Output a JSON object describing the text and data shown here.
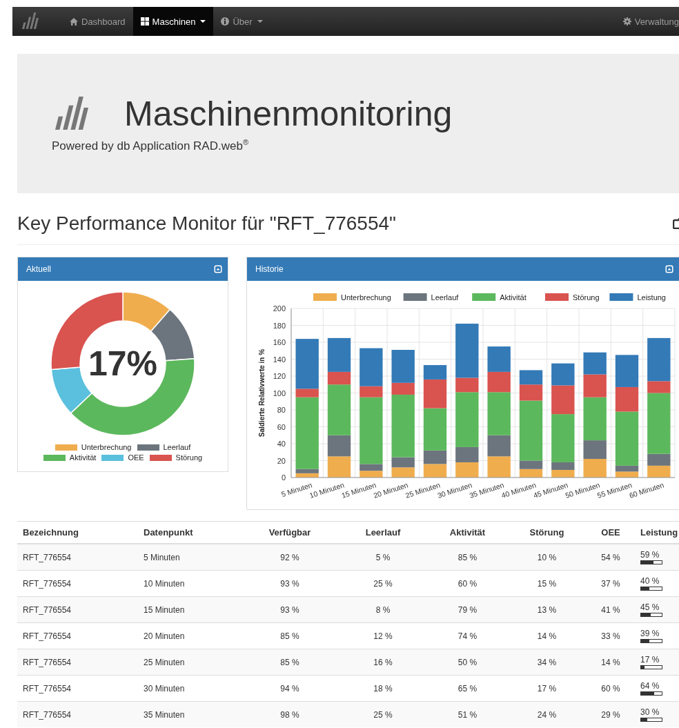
{
  "navbar": {
    "items": [
      {
        "label": "Dashboard",
        "selected": false,
        "dropdown": false
      },
      {
        "label": "Maschinen",
        "selected": true,
        "dropdown": true
      },
      {
        "label": "Über",
        "selected": false,
        "dropdown": true
      }
    ],
    "right_item": {
      "label": "Verwaltung"
    }
  },
  "jumbotron": {
    "title": "Maschinenmonitoring",
    "subtitle": "Powered by db Application RAD.web$^{®}$"
  },
  "page_title": "Key Performance Monitor für \"RFT_776554\"",
  "current_panel": {
    "title": "Aktuell",
    "center_value": "17%",
    "legend": [
      {
        "label": "Unterbrechung",
        "color": "#f0ad4e"
      },
      {
        "label": "Leerlauf",
        "color": "#6c757d"
      },
      {
        "label": "Aktivität",
        "color": "#5cb85c"
      },
      {
        "label": "OEE",
        "color": "#5bc0de"
      },
      {
        "label": "Störung",
        "color": "#d9534f"
      }
    ]
  },
  "history_panel": {
    "title": "Historie",
    "chart_data": {
      "type": "bar",
      "stacked": true,
      "grid": true,
      "legend": true,
      "ylabel": "Saldierte Relativwerte in %",
      "categories": [
        "5 Minuten",
        "10 Minuten",
        "15 Minuten",
        "20 Minuten",
        "25 Minuten",
        "30 Minuten",
        "35 Minuten",
        "40 Minuten",
        "45 Minuten",
        "50 Minuten",
        "55 Minuten",
        "60 Minuten"
      ],
      "ylim": [
        0,
        200
      ],
      "yticks": [
        0,
        20,
        40,
        60,
        80,
        100,
        120,
        140,
        160,
        180,
        200
      ],
      "series": [
        {
          "name": "Unterbrechung",
          "color": "#f0ad4e",
          "values": [
            5,
            25,
            8,
            12,
            16,
            18,
            25,
            10,
            9,
            22,
            7,
            14
          ]
        },
        {
          "name": "Leerlauf",
          "color": "#6c757d",
          "values": [
            5,
            25,
            8,
            12,
            16,
            18,
            25,
            10,
            9,
            22,
            7,
            14
          ]
        },
        {
          "name": "Aktivität",
          "color": "#5cb85c",
          "values": [
            85,
            60,
            79,
            74,
            50,
            65,
            51,
            71,
            57,
            51,
            64,
            72
          ]
        },
        {
          "name": "Störung",
          "color": "#d9534f",
          "values": [
            10,
            15,
            13,
            14,
            34,
            17,
            24,
            19,
            34,
            27,
            29,
            14
          ]
        },
        {
          "name": "Leistung",
          "color": "#337ab7",
          "values": [
            59,
            40,
            45,
            39,
            17,
            64,
            30,
            17,
            26,
            26,
            38,
            51
          ]
        }
      ]
    }
  },
  "table": {
    "columns": [
      "Bezeichnung",
      "Datenpunkt",
      "Verfügbar",
      "Leerlauf",
      "Aktivität",
      "Störung",
      "OEE",
      "Leistung"
    ],
    "rows": [
      {
        "cells": [
          "RFT_776554",
          "5 Minuten",
          "92 %",
          "5 %",
          "85 %",
          "10 %",
          "54 %"
        ],
        "leistung": "59 %",
        "level": 0.59
      },
      {
        "cells": [
          "RFT_776554",
          "10 Minuten",
          "93 %",
          "25 %",
          "60 %",
          "15 %",
          "37 %"
        ],
        "leistung": "40 %",
        "level": 0.4
      },
      {
        "cells": [
          "RFT_776554",
          "15 Minuten",
          "93 %",
          "8 %",
          "79 %",
          "13 %",
          "41 %"
        ],
        "leistung": "45 %",
        "level": 0.45
      },
      {
        "cells": [
          "RFT_776554",
          "20 Minuten",
          "85 %",
          "12 %",
          "74 %",
          "14 %",
          "33 %"
        ],
        "leistung": "39 %",
        "level": 0.39
      },
      {
        "cells": [
          "RFT_776554",
          "25 Minuten",
          "85 %",
          "16 %",
          "50 %",
          "34 %",
          "14 %"
        ],
        "leistung": "17 %",
        "level": 0.17
      },
      {
        "cells": [
          "RFT_776554",
          "30 Minuten",
          "94 %",
          "18 %",
          "65 %",
          "17 %",
          "60 %"
        ],
        "leistung": "64 %",
        "level": 0.64
      },
      {
        "cells": [
          "RFT_776554",
          "35 Minuten",
          "98 %",
          "25 %",
          "51 %",
          "24 %",
          "29 %"
        ],
        "leistung": "30 %",
        "level": 0.3
      }
    ]
  }
}
